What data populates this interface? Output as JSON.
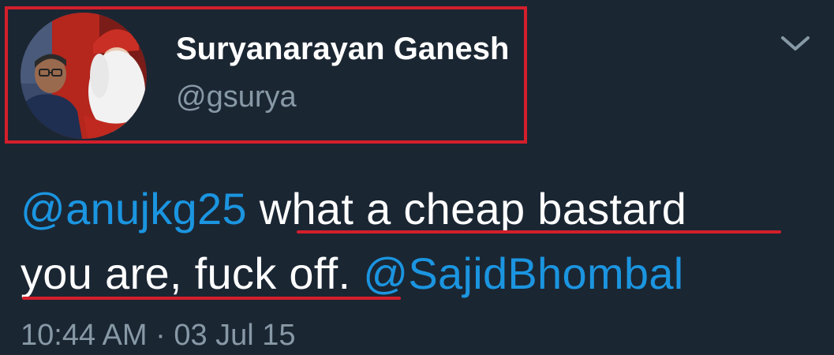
{
  "tweet": {
    "author": {
      "display_name": "Suryanarayan Ganesh",
      "handle": "@gsurya",
      "avatar_icon": "avatar-photo"
    },
    "body": {
      "mention_1": "@anujkg25",
      "text_part_1": "what a cheap bastard",
      "text_part_2": "you are, fuck off.",
      "mention_2": "@SajidBhombal"
    },
    "timestamp": "10:44 AM · 03 Jul 15",
    "menu_icon": "chevron-down-icon"
  },
  "colors": {
    "background": "#1b2633",
    "mention": "#1b95e0",
    "muted": "#8899a6",
    "highlight": "#d41e2b",
    "text": "#ffffff"
  }
}
